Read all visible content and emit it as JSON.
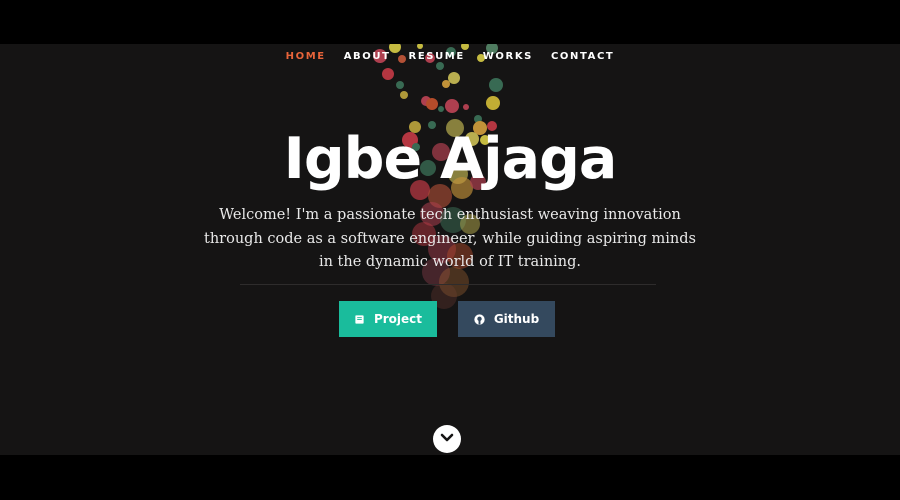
{
  "nav": {
    "items": [
      {
        "label": "HOME",
        "active": true
      },
      {
        "label": "ABOUT",
        "active": false
      },
      {
        "label": "RESUME",
        "active": false
      },
      {
        "label": "WORKS",
        "active": false
      },
      {
        "label": "CONTACT",
        "active": false
      }
    ]
  },
  "hero": {
    "title": "Igbe Ajaga",
    "intro": "Welcome! I'm a passionate tech enthusiast weaving innovation through code as a software engineer, while guiding aspiring minds in the dynamic world of IT training.",
    "buttons": {
      "project_label": "Project",
      "project_icon": "book-icon",
      "github_label": "Github",
      "github_icon": "github-icon"
    },
    "scroll_icon": "chevron-down-icon"
  },
  "colors": {
    "background": "#151414",
    "nav_active": "#e8643a",
    "project_button": "#1abc9c",
    "github_button": "#34495e",
    "text": "#ffffff"
  }
}
